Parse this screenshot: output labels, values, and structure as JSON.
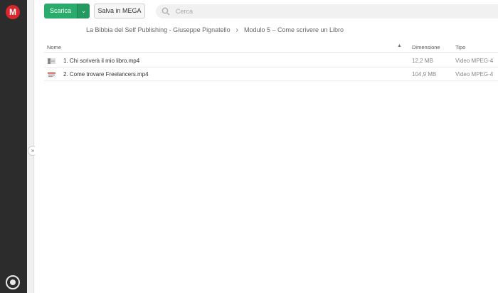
{
  "sidebar": {
    "logo_letter": "M",
    "logo_color": "#d9272e",
    "bottom_icon": "transfer-manager-icon"
  },
  "toolbar": {
    "download_label": "Scarica",
    "download_color": "#28ab6b",
    "save_label": "Salva in MEGA",
    "search_placeholder": "Cerca",
    "search_icon": "search-icon"
  },
  "breadcrumb": {
    "items": [
      "La Bibbia del Self Publishing - Giuseppe Pignatello",
      "Modulo 5 – Come scrivere un Libro"
    ],
    "separator": "›"
  },
  "table": {
    "columns": {
      "name": "Nome",
      "size": "Dimensione",
      "type": "Tipo"
    },
    "sort_indicator": "▲",
    "rows": [
      {
        "name": "1. Chi scriverà il mio libro.mp4",
        "size": "12,2 MB",
        "type": "Video MPEG-4"
      },
      {
        "name": "2. Come trovare Freelancers.mp4",
        "size": "104,9 MB",
        "type": "Video MPEG-4"
      }
    ]
  }
}
